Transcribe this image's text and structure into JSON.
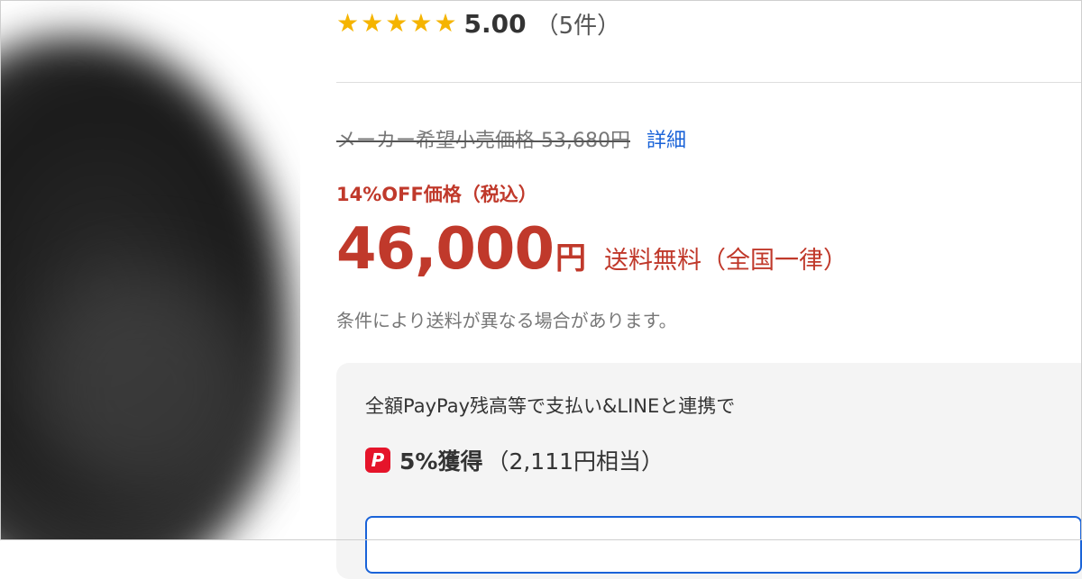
{
  "rating": {
    "stars": 5,
    "score": "5.00",
    "count": "（5件）"
  },
  "list_price": {
    "label": "メーカー希望小売価格 53,680円",
    "details_link": "詳細"
  },
  "price": {
    "discount_label": "14%OFF価格（税込）",
    "amount": "46,000",
    "unit": "円",
    "shipping": "送料無料（全国一律）",
    "shipping_note": "条件により送料が異なる場合があります。"
  },
  "points": {
    "description": "全額PayPay残高等で支払い&LINEと連携で",
    "icon": "paypay-icon",
    "rate": "5%獲得",
    "equivalent": "（2,111円相当）"
  },
  "colors": {
    "price_red": "#c0392b",
    "star_yellow": "#f5b400",
    "link_blue": "#1a63d8",
    "paypay_red": "#e5142a"
  }
}
